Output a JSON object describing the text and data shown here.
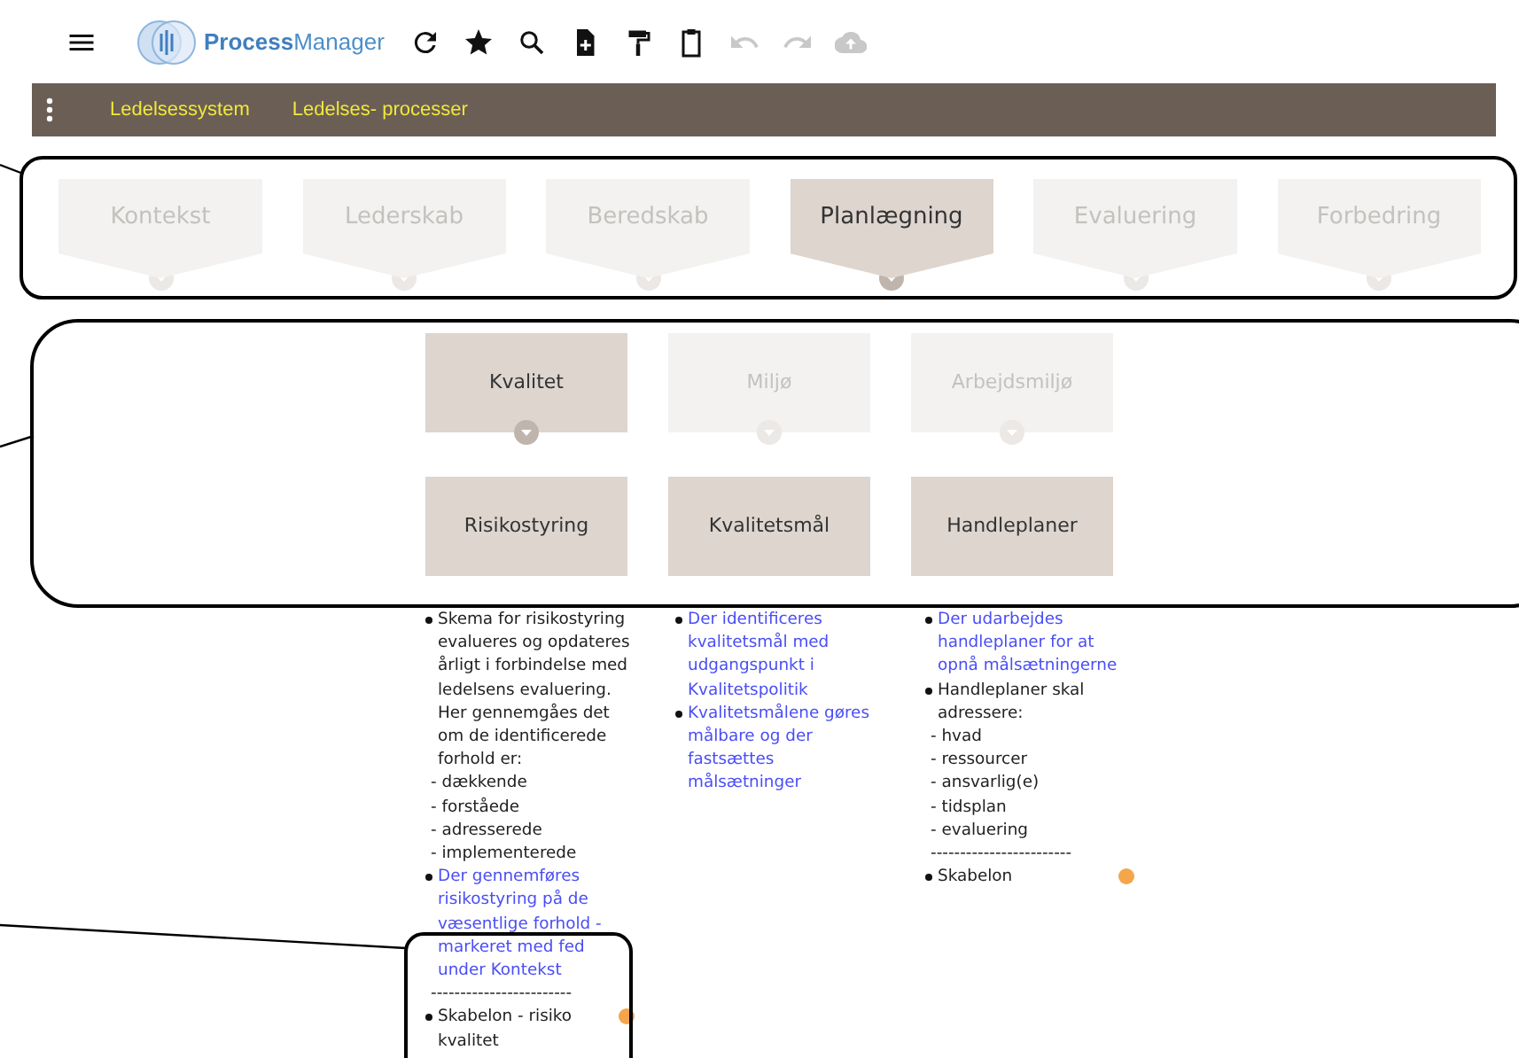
{
  "header": {
    "brand": "**Process**Manager",
    "toolbar": [
      {
        "disabled": false
      },
      {
        "disabled": false
      },
      {
        "disabled": false
      },
      {
        "disabled": false
      },
      {
        "disabled": false
      },
      {
        "disabled": false
      },
      {
        "disabled": true
      },
      {
        "disabled": true
      },
      {
        "disabled": true
      }
    ]
  },
  "breadcrumb": [
    "Ledelsessystem",
    "Ledelses- processer"
  ],
  "phases": [
    {
      "label": "Kontekst",
      "selected": false
    },
    {
      "label": "Lederskab",
      "selected": false
    },
    {
      "label": "Beredskab",
      "selected": false
    },
    {
      "label": "Planlægning",
      "selected": true
    },
    {
      "label": "Evaluering",
      "selected": false
    },
    {
      "label": "Forbedring",
      "selected": false
    }
  ],
  "categories": [
    {
      "label": "Kvalitet",
      "selected": true
    },
    {
      "label": "Miljø",
      "selected": false
    },
    {
      "label": "Arbejdsmiljø",
      "selected": false
    }
  ],
  "processes": [
    {
      "label": "Risikostyring",
      "items": [
        {
          "kind": "text",
          "text": "Skema for risikostyring evalueres og opdateres årligt i forbindelse med ledelsens evaluering. Her gennemgåes det om de identificerede forhold er:"
        },
        {
          "kind": "sub",
          "text": "- dækkende"
        },
        {
          "kind": "sub",
          "text": "- forståede"
        },
        {
          "kind": "sub",
          "text": "- adresserede"
        },
        {
          "kind": "sub",
          "text": "- implementerede"
        },
        {
          "kind": "link",
          "text": "Der gennemføres risikostyring på de væsentlige forhold - markeret med fed under Kontekst"
        },
        {
          "kind": "rule",
          "text": "------------------------"
        },
        {
          "kind": "template",
          "text": "Skabelon - risiko kvalitet"
        }
      ]
    },
    {
      "label": "Kvalitetsmål",
      "items": [
        {
          "kind": "link",
          "text": "Der identificeres kvalitetsmål med udgangspunkt i Kvalitetspolitik"
        },
        {
          "kind": "link",
          "text": "Kvalitetsmålene gøres målbare og der fastsættes målsætninger"
        }
      ]
    },
    {
      "label": "Handleplaner",
      "items": [
        {
          "kind": "link",
          "text": "Der udarbejdes handleplaner for at opnå målsætningerne"
        },
        {
          "kind": "text",
          "text": "Handleplaner skal adressere:"
        },
        {
          "kind": "sub",
          "text": "- hvad"
        },
        {
          "kind": "sub",
          "text": "- ressourcer"
        },
        {
          "kind": "sub",
          "text": "- ansvarlig(e)"
        },
        {
          "kind": "sub",
          "text": "- tidsplan"
        },
        {
          "kind": "sub",
          "text": "- evaluering"
        },
        {
          "kind": "rule",
          "text": "------------------------"
        },
        {
          "kind": "template",
          "text": "Skabelon"
        }
      ]
    }
  ]
}
